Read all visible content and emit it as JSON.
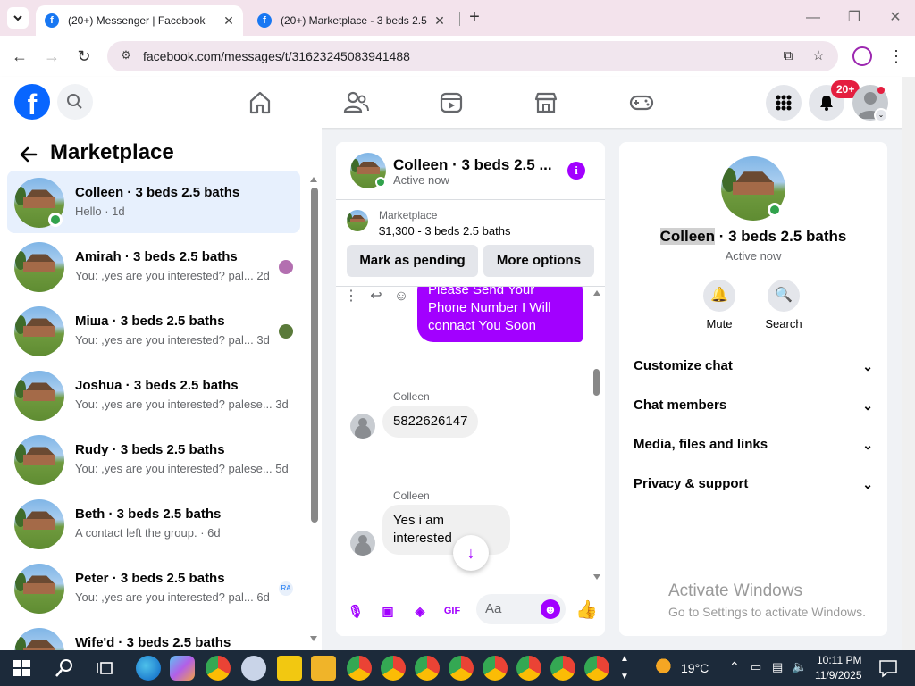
{
  "browser": {
    "tabs": [
      {
        "title": "(20+) Messenger | Facebook",
        "active": true
      },
      {
        "title": "(20+) Marketplace - 3 beds 2.5",
        "active": false
      }
    ],
    "url": "facebook.com/messages/t/31623245083941488"
  },
  "fb_header": {
    "notifications_badge": "20+",
    "nav_icons": [
      "home-icon",
      "friends-icon",
      "watch-icon",
      "marketplace-icon",
      "gaming-icon"
    ]
  },
  "left_panel": {
    "title": "Marketplace",
    "conversations": [
      {
        "name": "Colleen · 3 beds 2.5 baths",
        "preview": "Hello · 1d",
        "selected": true
      },
      {
        "name": "Amirah · 3 beds 2.5 baths",
        "preview": "You: ,yes are you interested? pal...",
        "time": "2d"
      },
      {
        "name": "Міша · 3 beds 2.5 baths",
        "preview": "You: ,yes are you interested? pal...",
        "time": "3d"
      },
      {
        "name": "Joshua · 3 beds 2.5 baths",
        "preview": "You: ,yes are you interested? palese...",
        "time": "3d"
      },
      {
        "name": "Rudy · 3 beds 2.5 baths",
        "preview": "You: ,yes are you interested? palese...",
        "time": "5d"
      },
      {
        "name": "Beth · 3 beds 2.5 baths",
        "preview": "A contact left the group. · 6d"
      },
      {
        "name": "Peter · 3 beds 2.5 baths",
        "preview": "You: ,yes are you interested? pal...",
        "time": "6d"
      },
      {
        "name": "Wife'd · 3 beds 2.5 baths",
        "preview": ""
      }
    ]
  },
  "chat": {
    "name": "Colleen · 3 beds 2.5 ...",
    "status": "Active now",
    "marketplace_label": "Marketplace",
    "item": "$1,300 - 3 beds 2.5 baths",
    "mark_pending": "Mark as pending",
    "more_options": "More options",
    "outgoing_message": "Please Send Your Phone Number I Will connact You Soon",
    "messages": [
      {
        "sender": "Colleen",
        "text": "5822626147"
      },
      {
        "sender": "Colleen",
        "text": "Yes i am interested"
      }
    ],
    "composer_placeholder": "Aa"
  },
  "right_panel": {
    "name_highlight": "Colleen",
    "name_rest": " · 3 beds 2.5 baths",
    "status": "Active now",
    "actions": [
      {
        "label": "Mute",
        "icon": "bell-icon"
      },
      {
        "label": "Search",
        "icon": "search-icon"
      }
    ],
    "sections": [
      "Customize chat",
      "Chat members",
      "Media, files and links",
      "Privacy & support"
    ],
    "watermark_title": "Activate Windows",
    "watermark_sub": "Go to Settings to activate Windows."
  },
  "taskbar": {
    "weather": "19°C",
    "time": "10:11 PM",
    "date": "11/9/2025"
  },
  "colors": {
    "accent": "#a200ff",
    "fb_blue": "#0866ff",
    "online": "#31a24c",
    "badge": "#e41e3f"
  }
}
